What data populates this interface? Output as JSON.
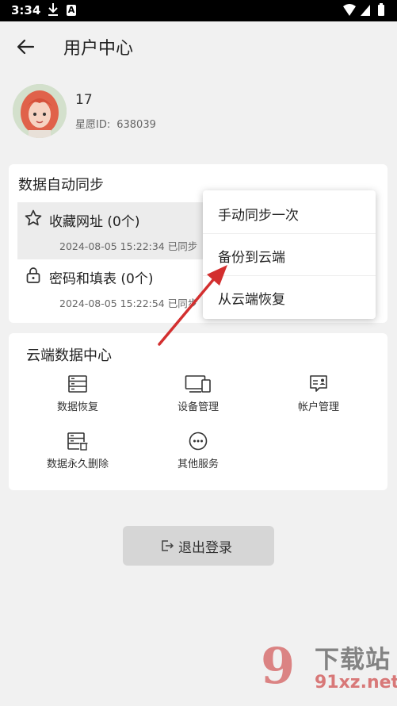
{
  "status_bar": {
    "time": "3:34"
  },
  "header": {
    "title": "用户中心"
  },
  "profile": {
    "name": "17",
    "id_label": "星愿ID:",
    "id_value": "638039"
  },
  "sync_card": {
    "title": "数据自动同步",
    "items": [
      {
        "label": "收藏网址 (0个)",
        "timestamp": "2024-08-05 15:22:34 已同步",
        "icon": "star-icon"
      },
      {
        "label": "密码和填表 (0个)",
        "timestamp": "2024-08-05 15:22:54 已同步",
        "icon": "lock-icon"
      }
    ]
  },
  "popup_menu": {
    "items": [
      {
        "label": "手动同步一次"
      },
      {
        "label": "备份到云端"
      },
      {
        "label": "从云端恢复"
      }
    ]
  },
  "cloud_card": {
    "title": "云端数据中心",
    "items": [
      {
        "label": "数据恢复",
        "icon": "server-icon"
      },
      {
        "label": "设备管理",
        "icon": "devices-icon"
      },
      {
        "label": "帐户管理",
        "icon": "account-card-icon"
      },
      {
        "label": "数据永久删除",
        "icon": "server-delete-icon"
      },
      {
        "label": "其他服务",
        "icon": "more-circle-icon"
      }
    ]
  },
  "logout": {
    "label": "退出登录"
  },
  "watermark": {
    "text": "下载站",
    "url": "91xz.net"
  },
  "colors": {
    "background": "#f1f1f1",
    "card": "#ffffff",
    "arrow": "#d32f2f",
    "logout_bg": "#d6d6d6"
  }
}
